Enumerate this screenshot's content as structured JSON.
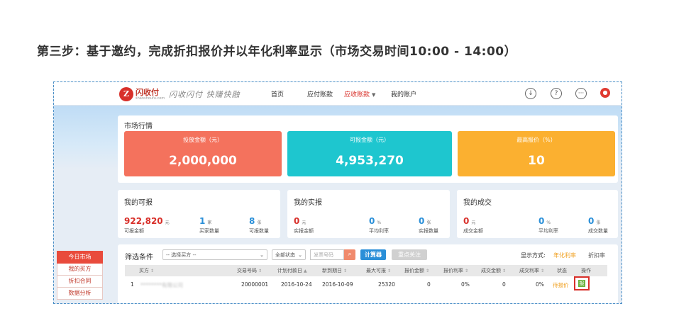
{
  "step_title": "第三步：基于邀约，完成折扣报价并以年化利率显示（市场交易时间10:00 - 14:00）",
  "header": {
    "logo_mark": "Z",
    "logo_name": "闪收付",
    "logo_sub": "shanshoufu.com",
    "slogan": "闪收闪付 快赚快融",
    "nav": [
      {
        "label": "首页"
      },
      {
        "label": "应付账款"
      },
      {
        "label": "应收账款",
        "active": true
      },
      {
        "label": "我的账户"
      }
    ],
    "icons": [
      "download-icon",
      "help-icon",
      "more-icon",
      "user-icon"
    ]
  },
  "market": {
    "title": "市场行情",
    "cards": [
      {
        "label": "投放金额（元）",
        "value": "2,000,000",
        "color": "#f4725d"
      },
      {
        "label": "可报金额（元）",
        "value": "4,953,270",
        "color": "#1ec6cf"
      },
      {
        "label": "最高报价（%）",
        "value": "10",
        "color": "#fbb030"
      }
    ]
  },
  "my_available": {
    "title": "我的可报",
    "m1": {
      "num": "922,820",
      "unit": "元",
      "label": "可报金额"
    },
    "m2": {
      "num": "1",
      "unit": "家",
      "label": "买家数量"
    },
    "m3": {
      "num": "8",
      "unit": "张",
      "label": "可报数量"
    }
  },
  "my_quoted": {
    "title": "我的实报",
    "m1": {
      "num": "0",
      "unit": "元",
      "label": "实报金额"
    },
    "m2": {
      "num": "0",
      "unit": "%",
      "label": "平均利率"
    },
    "m3": {
      "num": "0",
      "unit": "张",
      "label": "实报数量"
    }
  },
  "my_deals": {
    "title": "我的成交",
    "m1": {
      "num": "0",
      "unit": "元",
      "label": "成交金额"
    },
    "m2": {
      "num": "0",
      "unit": "%",
      "label": "平均利率"
    },
    "m3": {
      "num": "0",
      "unit": "张",
      "label": "成交数量"
    }
  },
  "sidebar": {
    "items": [
      "今日市场",
      "我的买方",
      "折扣合同",
      "数据分析"
    ]
  },
  "filter": {
    "label": "筛选条件",
    "buyer_select": "-- 选择买方 --",
    "status_select": "全部状态",
    "search_placeholder": "发票号码",
    "calc_button": "计算器",
    "reset_button": "重点关注",
    "display_mode_label": "显示方式:",
    "mode_annual": "年化利率",
    "mode_discount": "折扣率"
  },
  "table": {
    "headers": [
      "买方",
      "交易号码",
      "计划付款日",
      "新到期日",
      "最大可报",
      "报价金额",
      "报价利率",
      "成交金额",
      "成交利率",
      "状态",
      "操作"
    ],
    "rows": [
      {
        "index": "1",
        "buyer": "********有限公司",
        "trade_no": "20000001",
        "plan_date": "2016-10-24",
        "new_due": "2016-10-09",
        "max_quote": "25320",
        "quote_amt": "0",
        "quote_rate": "0%",
        "deal_amt": "0",
        "deal_rate": "0%",
        "status": "待报价",
        "op_icon": "quote-icon"
      }
    ]
  }
}
